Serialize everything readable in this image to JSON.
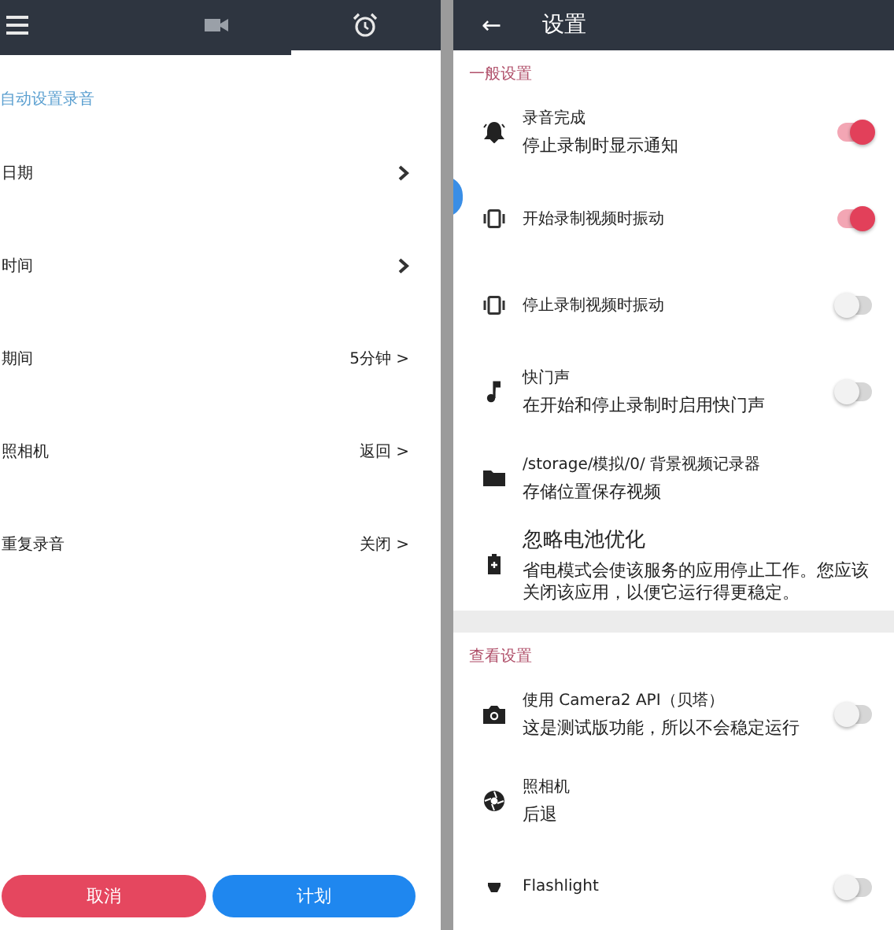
{
  "schedule_screen": {
    "tabs": [
      {
        "kind": "menu",
        "selected": false
      },
      {
        "kind": "video",
        "selected": false
      },
      {
        "kind": "alarm",
        "selected": true
      }
    ],
    "section_title": "自动设置录音",
    "rows": [
      {
        "label": "日期",
        "value": ""
      },
      {
        "label": "时间",
        "value": ""
      },
      {
        "label": "期间",
        "value": "5分钟 >"
      },
      {
        "label": "照相机",
        "value": "返回 >"
      },
      {
        "label": "重复录音",
        "value": "关闭 >"
      }
    ],
    "buttons": [
      {
        "label": "取消",
        "kind": "cancel"
      },
      {
        "label": "计划",
        "kind": "confirm"
      }
    ]
  },
  "settings_screen": {
    "back": "←",
    "title": "设置",
    "sections": [
      {
        "title": "一般设置",
        "items": [
          {
            "kind": "toggle",
            "title": "录音完成",
            "summary": "停止录制时显示通知",
            "on": true
          },
          {
            "kind": "toggle",
            "title": "开始录制视频时振动",
            "on": true
          },
          {
            "kind": "toggle",
            "title": "停止录制视频时振动",
            "on": false
          },
          {
            "kind": "toggle",
            "title": "快门声",
            "summary": "在开始和停止录制时启用快门声",
            "on": false
          },
          {
            "kind": "plain",
            "title": "/storage/模拟/0/ 背景视频记录器",
            "summary": "存储位置保存视频"
          },
          {
            "kind": "plain",
            "title": "忽略电池优化",
            "summary": "省电模式会使该服务的应用停止工作。您应该关闭该应用，以便它运行得更稳定。"
          }
        ]
      },
      {
        "title": "查看设置",
        "items": [
          {
            "kind": "toggle",
            "title": "使用 Camera2 API（贝塔）",
            "summary": "这是测试版功能，所以不会稳定运行",
            "on": false
          },
          {
            "kind": "plain",
            "title": "照相机",
            "summary": "后退"
          },
          {
            "kind": "toggle",
            "title": "Flashlight",
            "on": false
          }
        ]
      }
    ]
  }
}
